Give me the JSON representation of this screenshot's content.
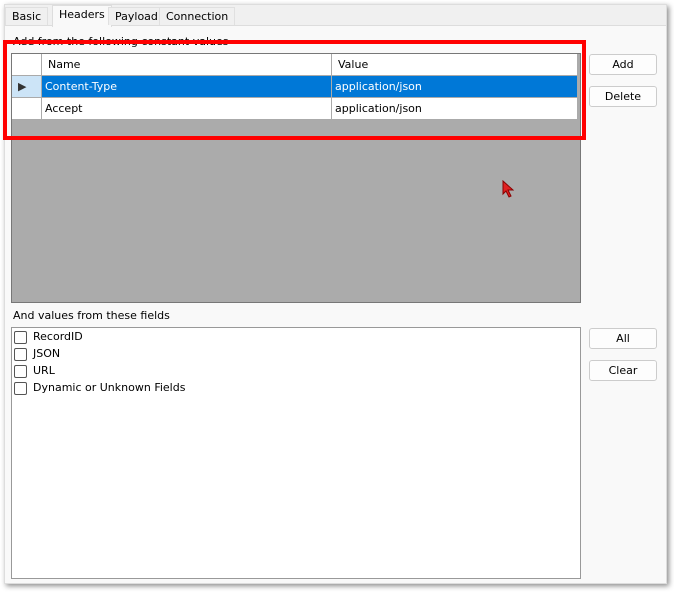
{
  "tabs": [
    "Basic",
    "Headers",
    "Payload",
    "Connection"
  ],
  "constants_label": "Add from the following constant values",
  "grid": {
    "columns": [
      "Name",
      "Value"
    ],
    "rows": [
      {
        "name": "Content-Type",
        "value": "application/json"
      },
      {
        "name": "Accept",
        "value": "application/json"
      }
    ]
  },
  "buttons": {
    "add": "Add",
    "delete": "Delete",
    "all": "All",
    "clear": "Clear"
  },
  "fields_label": "And values from these fields",
  "fields": [
    "RecordID",
    "JSON",
    "URL",
    "Dynamic or Unknown Fields"
  ],
  "colors": {
    "accent": "#0078d7",
    "highlight": "#ff0000"
  }
}
